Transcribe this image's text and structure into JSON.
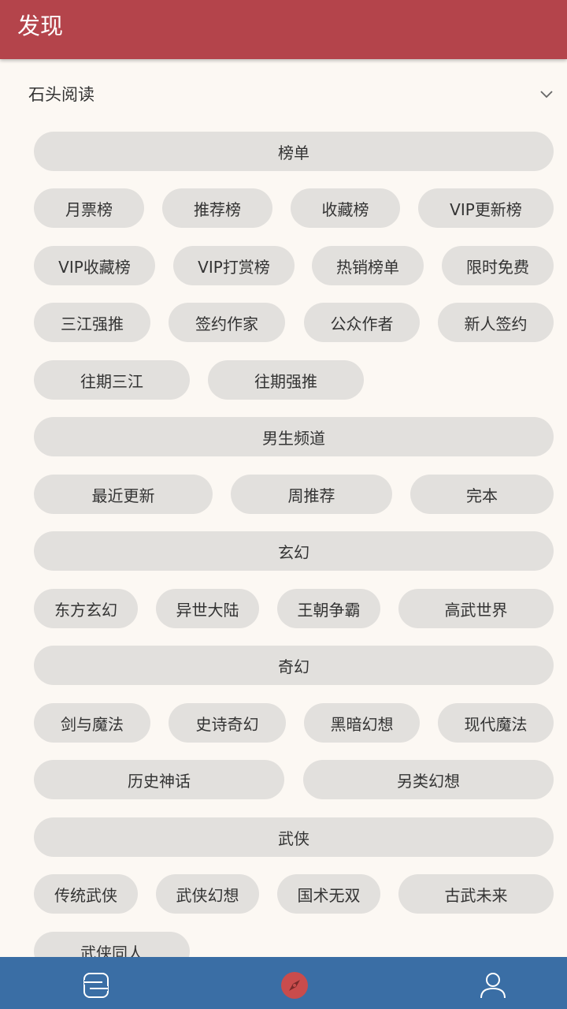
{
  "appbar": {
    "title": "发现"
  },
  "source_selector": {
    "label": "石头阅读",
    "icon": "chevron-down-icon"
  },
  "rows": [
    [
      "榜单"
    ],
    [
      "月票榜",
      "推荐榜",
      "收藏榜",
      "VIP更新榜"
    ],
    [
      "VIP收藏榜",
      "VIP打赏榜",
      "热销榜单",
      "限时免费"
    ],
    [
      "三江强推",
      "签约作家",
      "公众作者",
      "新人签约"
    ],
    [
      "往期三江",
      "往期强推"
    ],
    [
      "男生频道"
    ],
    [
      "最近更新",
      "周推荐",
      "完本"
    ],
    [
      "玄幻"
    ],
    [
      "东方玄幻",
      "异世大陆",
      "王朝争霸",
      "高武世界"
    ],
    [
      "奇幻"
    ],
    [
      "剑与魔法",
      "史诗奇幻",
      "黑暗幻想",
      "现代魔法"
    ],
    [
      "历史神话",
      "另类幻想"
    ],
    [
      "武侠"
    ],
    [
      "传统武侠",
      "武侠幻想",
      "国术无双",
      "古武未来"
    ],
    [
      "武侠同人"
    ]
  ],
  "bottom_nav": [
    {
      "name": "bookshelf-tab",
      "icon": "bookshelf-icon",
      "active": false
    },
    {
      "name": "discover-tab",
      "icon": "compass-icon",
      "active": true
    },
    {
      "name": "profile-tab",
      "icon": "person-icon",
      "active": false
    }
  ],
  "colors": {
    "appbar": "#b4444b",
    "background": "#fcf8f3",
    "chip": "#e2e0dd",
    "bottombar": "#3a6ea5",
    "active_icon": "#c94c4c"
  }
}
